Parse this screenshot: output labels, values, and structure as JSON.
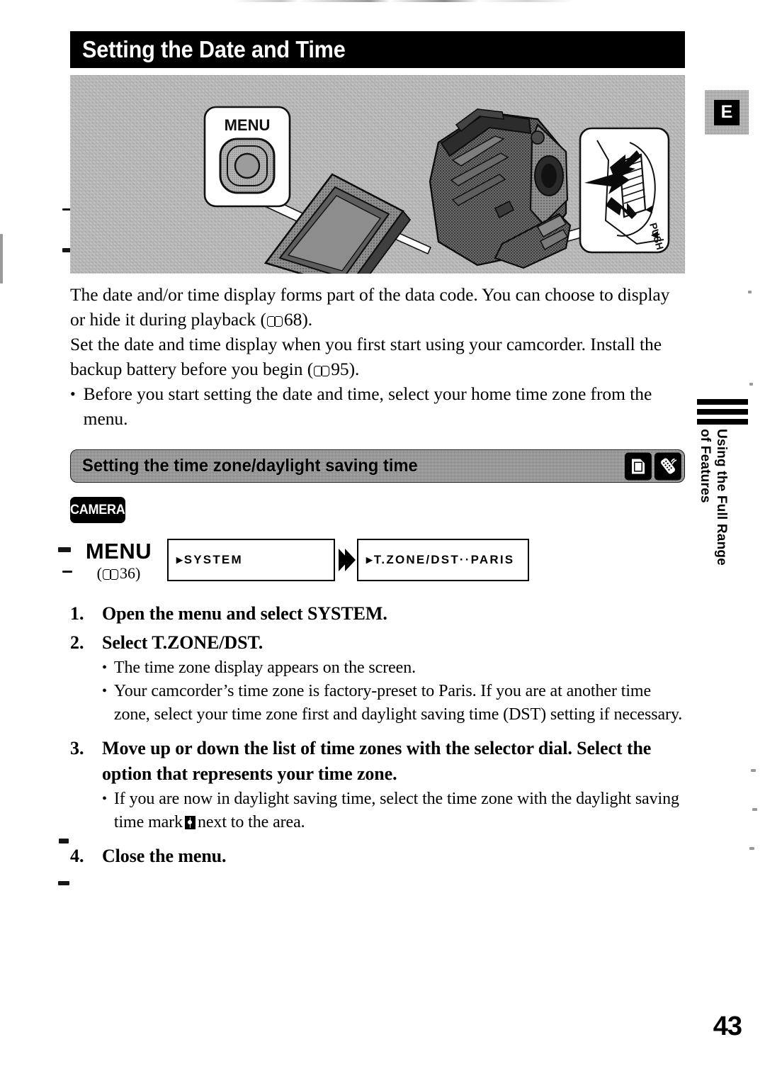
{
  "page": {
    "title": "Setting the Date and Time",
    "number": "43",
    "language_tab": "E"
  },
  "side_tab": {
    "text": "Using the Full Range of Features"
  },
  "illustration": {
    "menu_callout_label": "MENU",
    "dial_callout_label": "PUSH",
    "alt": "Camcorder with open LCD panel, MENU button callout and selector dial callout"
  },
  "intro": {
    "paragraph_1_part_1": "The date and/or time display forms part of the data code. You can choose to display or hide it during playback (",
    "paragraph_1_ref": "68",
    "paragraph_1_part_2": ").",
    "paragraph_2_part_1": "Set the date and time display when you first start using your camcorder. Install the backup battery before you begin (",
    "paragraph_2_ref": "95",
    "paragraph_2_part_2": ").",
    "bullet_marker": "•",
    "bullet_1": "Before you start setting the date and time, select your home time zone from the menu."
  },
  "section": {
    "heading": "Setting the time zone/daylight saving time",
    "icons": [
      "card-screen-icon",
      "wireless-remote-icon"
    ]
  },
  "mode_badge": {
    "label": "CAMERA"
  },
  "menu_flow": {
    "menu_label": "MENU",
    "menu_ref_open": "(",
    "menu_ref_page": "36",
    "menu_ref_close": ")",
    "arrow_icon": "double-chevron-right-icon",
    "box_1": "▸SYSTEM",
    "box_2": "▸T.ZONE/DST··PARIS"
  },
  "steps": [
    {
      "number": "1.",
      "text": "Open the menu and select SYSTEM.",
      "substeps": []
    },
    {
      "number": "2.",
      "text": "Select T.ZONE/DST.",
      "substeps": [
        "The time zone display appears on the screen.",
        "Your camcorder’s time zone is factory-preset to Paris. If you are at another time zone, select your time zone first and daylight saving time (DST) setting if necessary."
      ]
    },
    {
      "number": "3.",
      "text": "Move up or down the list of time zones with the selector dial. Select the option that represents your time zone.",
      "substeps": []
    },
    {
      "number": "4.",
      "text": "Close the menu.",
      "substeps": []
    }
  ],
  "step3_substep": {
    "marker": "•",
    "part_1": "If you are now in daylight saving time, select the time zone with the daylight saving time mark",
    "part_2": "next to the area."
  },
  "substep_marker": "•"
}
